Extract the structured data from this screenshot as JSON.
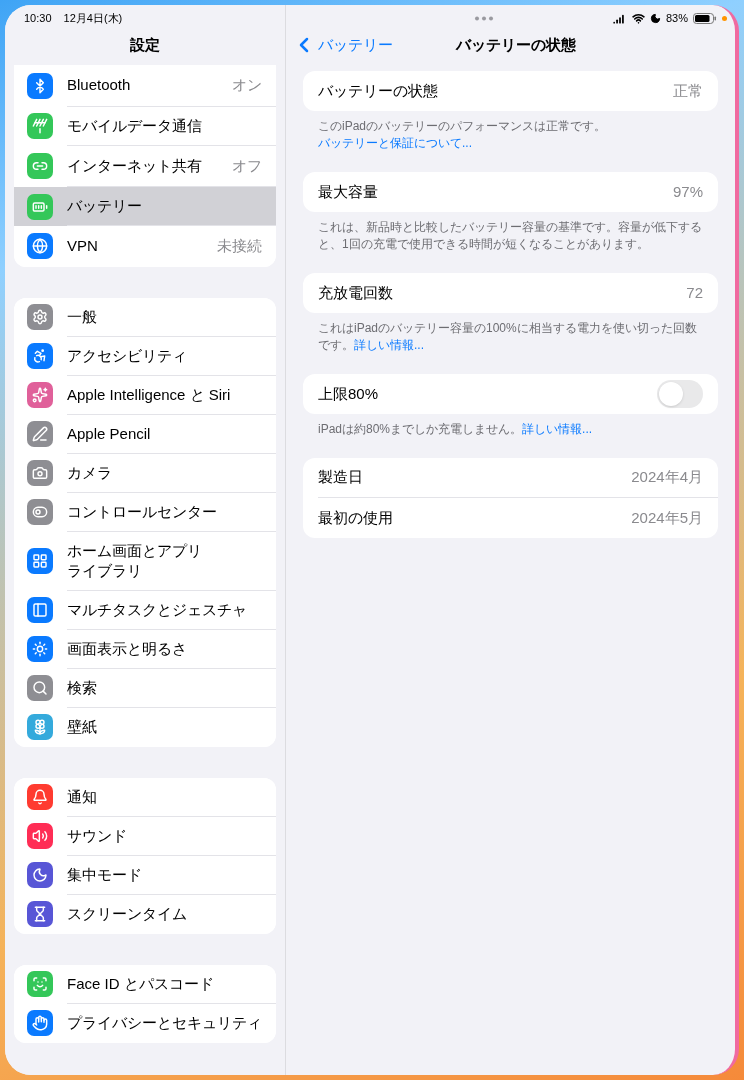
{
  "status_bar": {
    "time": "10:30",
    "date": "12月4日(木)",
    "battery": "83%"
  },
  "sidebar": {
    "title": "設定",
    "groups": [
      {
        "items": [
          {
            "label": "Bluetooth",
            "value": "オン",
            "selected": false,
            "color": "#0a7aff"
          },
          {
            "label": "モバイルデータ通信",
            "selected": false,
            "color": "#34c759"
          },
          {
            "label": "インターネット共有",
            "value": "オフ",
            "selected": false,
            "color": "#34c759"
          },
          {
            "label": "バッテリー",
            "selected": true,
            "color": "#34c759"
          },
          {
            "label": "VPN",
            "value": "未接続",
            "selected": false,
            "color": "#0a7aff"
          }
        ]
      },
      {
        "items": [
          {
            "label": "一般",
            "selected": false,
            "color": "#8e8e93"
          },
          {
            "label": "アクセシビリティ",
            "selected": false,
            "color": "#0a7aff"
          },
          {
            "label": "Apple Intelligence と Siri",
            "selected": false,
            "color": "#e0609a"
          },
          {
            "label": "Apple Pencil",
            "selected": false,
            "color": "#8e8e93"
          },
          {
            "label": "カメラ",
            "selected": false,
            "color": "#8e8e93"
          },
          {
            "label": "コントロールセンター",
            "selected": false,
            "color": "#8e8e93"
          },
          {
            "label_lines": [
              "ホーム画面とアプリ",
              "ライブラリ"
            ],
            "selected": false,
            "color": "#0a7aff"
          },
          {
            "label": "マルチタスクとジェスチャ",
            "selected": false,
            "color": "#0a7aff"
          },
          {
            "label": "画面表示と明るさ",
            "selected": false,
            "color": "#0a7aff"
          },
          {
            "label": "検索",
            "selected": false,
            "color": "#8e8e93"
          },
          {
            "label": "壁紙",
            "selected": false,
            "color": "#34aadc"
          }
        ]
      },
      {
        "items": [
          {
            "label": "通知",
            "selected": false,
            "color": "#ff3b30"
          },
          {
            "label": "サウンド",
            "selected": false,
            "color": "#ff2d55"
          },
          {
            "label": "集中モード",
            "selected": false,
            "color": "#5856d6"
          },
          {
            "label": "スクリーンタイム",
            "selected": false,
            "color": "#5856d6"
          }
        ]
      },
      {
        "items": [
          {
            "label": "Face ID とパスコード",
            "selected": false,
            "color": "#34c759"
          },
          {
            "label": "プライバシーとセキュリティ",
            "selected": false,
            "color": "#0a7aff"
          }
        ]
      }
    ]
  },
  "detail": {
    "back": "バッテリー",
    "title": "バッテリーの状態",
    "sections": [
      {
        "rows": [
          {
            "kind": "value",
            "label": "バッテリーの状態",
            "value": "正常"
          }
        ],
        "footer": {
          "text": "このiPadのバッテリーのパフォーマンスは正常です。",
          "link": "バッテリーと保証について..."
        }
      },
      {
        "rows": [
          {
            "kind": "value",
            "label": "最大容量",
            "value": "97%"
          }
        ],
        "footer": {
          "text": "これは、新品時と比較したバッテリー容量の基準です。容量が低下すると、1回の充電で使用できる時間が短くなることがあります。"
        }
      },
      {
        "rows": [
          {
            "kind": "value",
            "label": "充放電回数",
            "value": "72"
          }
        ],
        "footer": {
          "text": "これはiPadのバッテリー容量の100%に相当する電力を使い切った回数です。",
          "link": "詳しい情報..."
        }
      },
      {
        "rows": [
          {
            "kind": "toggle",
            "label": "上限80%",
            "on": false
          }
        ],
        "footer": {
          "text": "iPadは約80%までしか充電しません。",
          "link": "詳しい情報..."
        }
      },
      {
        "rows": [
          {
            "kind": "value",
            "label": "製造日",
            "value": "2024年4月"
          },
          {
            "kind": "value",
            "label": "最初の使用",
            "value": "2024年5月"
          }
        ]
      }
    ]
  }
}
